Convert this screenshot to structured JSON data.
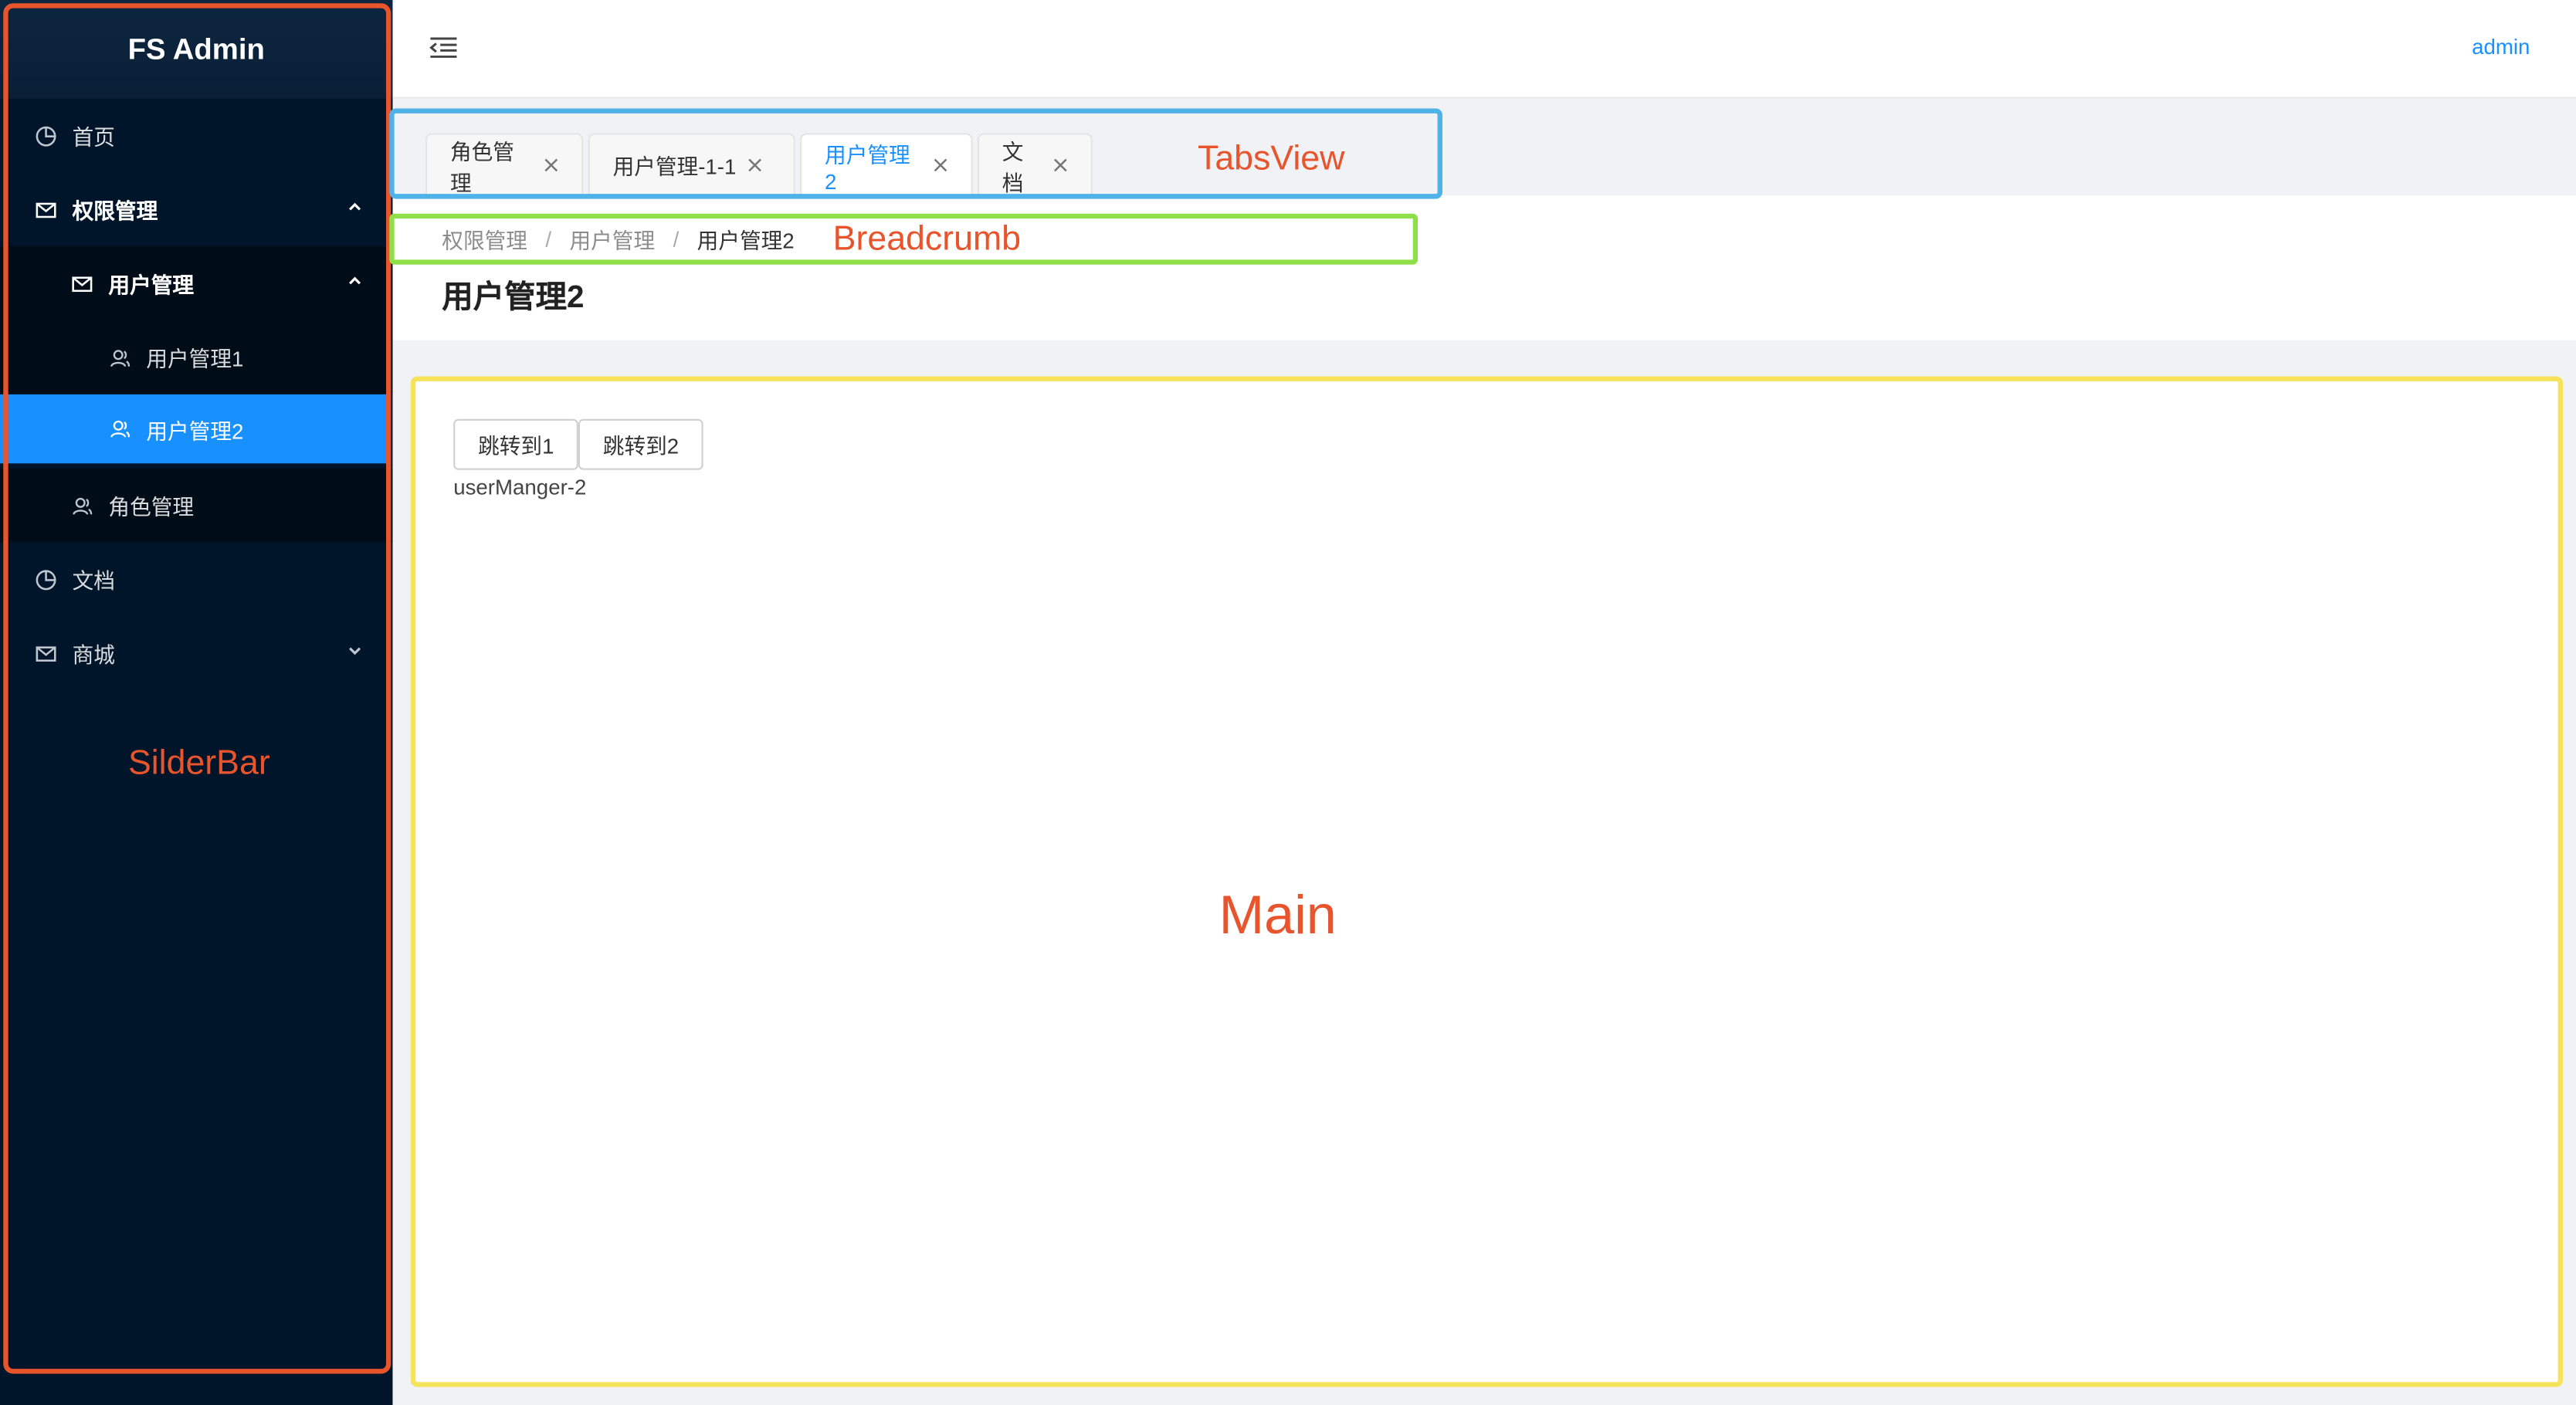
{
  "app": {
    "title": "FS Admin"
  },
  "sidebar": {
    "items": [
      {
        "label": "首页"
      },
      {
        "label": "权限管理"
      },
      {
        "label": "用户管理"
      },
      {
        "label": "用户管理1"
      },
      {
        "label": "用户管理2"
      },
      {
        "label": "角色管理"
      },
      {
        "label": "文档"
      },
      {
        "label": "商城"
      }
    ],
    "zone_label": "SilderBar"
  },
  "header": {
    "user": "admin"
  },
  "tabs": {
    "items": [
      {
        "label": "角色管理"
      },
      {
        "label": "用户管理-1-1"
      },
      {
        "label": "用户管理2",
        "active": true
      },
      {
        "label": "文档"
      }
    ],
    "zone_label": "TabsView"
  },
  "breadcrumb": {
    "items": [
      "权限管理",
      "用户管理",
      "用户管理2"
    ],
    "separator": "/",
    "zone_label": "Breadcrumb"
  },
  "page": {
    "title": "用户管理2"
  },
  "main": {
    "buttons": [
      "跳转到1",
      "跳转到2"
    ],
    "text": "userManger-2",
    "zone_label": "Main"
  },
  "colors": {
    "sidebar_bg": "#001529",
    "active_item": "#1890ff",
    "sidebar_zone": "#e8542c",
    "tabs_zone": "#4fb3ea",
    "breadcrumb_zone": "#8fdf4a",
    "main_zone": "#f5e35c",
    "zone_label_text": "#e8542c"
  }
}
